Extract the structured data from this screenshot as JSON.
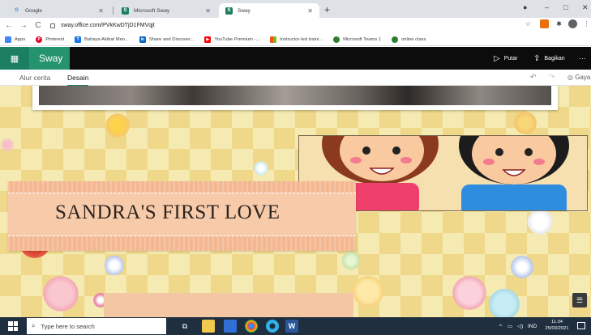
{
  "browser": {
    "tabs": [
      {
        "title": "Google",
        "favicon": "G",
        "color": "#4285f4"
      },
      {
        "title": "Microsoft Sway",
        "favicon": "S",
        "color": "#1d7f61"
      },
      {
        "title": "Sway",
        "favicon": "S",
        "color": "#1d7f61"
      }
    ],
    "new_tab": "+",
    "window_controls": {
      "minimize": "–",
      "maximize": "□",
      "close": "✕"
    },
    "url": "sway.office.com/PVkKwDTjD1FMVqjt",
    "nav": {
      "back": "←",
      "forward": "→",
      "reload": "C"
    },
    "bookmarks": [
      {
        "label": "Apps",
        "icon": "apps-icon",
        "color": "#4285f4"
      },
      {
        "label": "Pinterest",
        "icon": "pinterest-icon",
        "color": "#e60023"
      },
      {
        "label": "Bahaya Akibat Men...",
        "icon": "bookmark-icon",
        "color": "#1a73e8"
      },
      {
        "label": "Share and Discover...",
        "icon": "linkedin-icon",
        "color": "#0a66c2"
      },
      {
        "label": "YouTube Premium -...",
        "icon": "youtube-icon",
        "color": "#ff0000"
      },
      {
        "label": "Instructor-led traini...",
        "icon": "microsoft-icon",
        "color": "#f25022"
      },
      {
        "label": "Microsoft Teams 1",
        "icon": "teams-icon",
        "color": "#2e7d32"
      },
      {
        "label": "online class",
        "icon": "teams-icon",
        "color": "#2e7d32"
      }
    ]
  },
  "sway": {
    "app_name": "Sway",
    "actions": {
      "play": "Putar",
      "share": "Bagikan",
      "more": "···"
    },
    "tabs": {
      "storyline": "Alur cerita",
      "design": "Desain"
    },
    "styles": "Gaya"
  },
  "canvas": {
    "title": "SANDRA'S FIRST LOVE"
  },
  "taskbar": {
    "search_placeholder": "Type here to search",
    "language": "IND",
    "time": "11.04",
    "date": "25/03/2021"
  },
  "colors": {
    "sway_green": "#1d7f61",
    "background_yellow": "#f5eab1",
    "banner_peach": "#f3b891"
  }
}
